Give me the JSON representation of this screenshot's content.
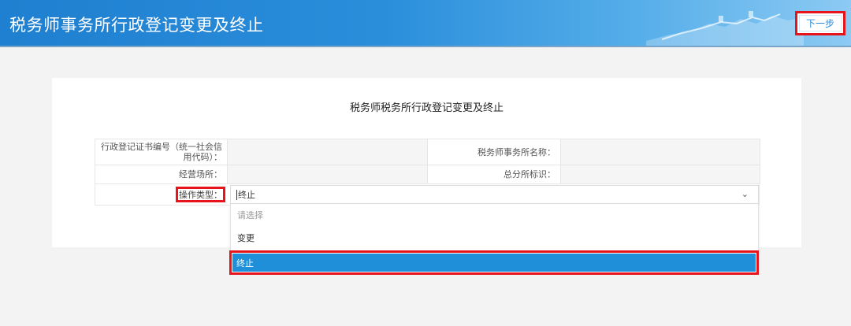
{
  "header": {
    "title": "税务师事务所行政登记变更及终止",
    "next_label": "下一步"
  },
  "form": {
    "title": "税务师税务所行政登记变更及终止",
    "cert_no_label": "行政登记证书编号（统一社会信用代码）：",
    "firm_name_label": "税务师事务所名称：",
    "address_label": "经营场所：",
    "branch_label": "总分所标识：",
    "op_type_label": "操作类型："
  },
  "select": {
    "value": "终止",
    "options": [
      "请选择",
      "变更",
      "终止"
    ]
  },
  "colors": {
    "header_blue": "#1f7fd0",
    "highlight": "#e8141c",
    "selected": "#1e8fd8"
  }
}
